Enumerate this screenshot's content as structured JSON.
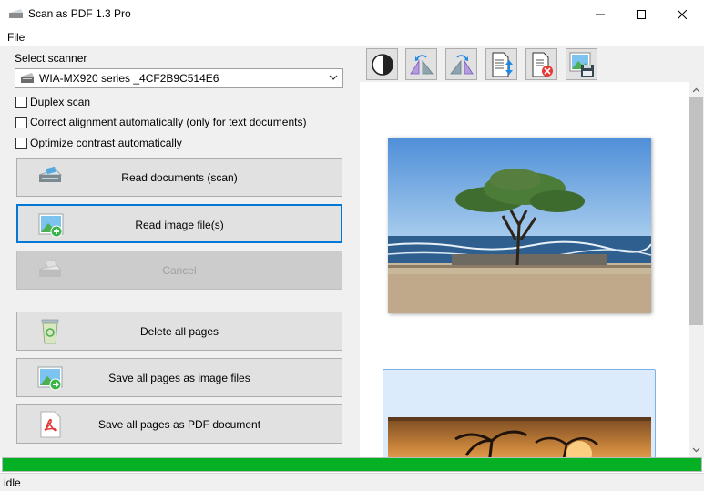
{
  "window": {
    "title": "Scan as PDF 1.3 Pro",
    "controls": [
      "minimize",
      "maximize",
      "close"
    ]
  },
  "menu": {
    "items": [
      {
        "label": "File"
      }
    ]
  },
  "scanner": {
    "label": "Select scanner",
    "selected": "WIA-MX920 series _4CF2B9C514E6"
  },
  "options": [
    {
      "label": "Duplex scan",
      "checked": false
    },
    {
      "label": "Correct alignment automatically (only for text documents)",
      "checked": false
    },
    {
      "label": "Optimize contrast automatically",
      "checked": false
    }
  ],
  "actions": {
    "scan": {
      "label": "Read documents (scan)",
      "icon": "scanner-icon"
    },
    "read_image": {
      "label": "Read image file(s)",
      "icon": "add-image-icon",
      "focused": true
    },
    "cancel": {
      "label": "Cancel",
      "icon": "scanner-disabled-icon",
      "enabled": false
    },
    "delete_all": {
      "label": "Delete all pages",
      "icon": "recycle-bin-icon"
    },
    "save_images": {
      "label": "Save all pages as image files",
      "icon": "save-image-icon"
    },
    "save_pdf": {
      "label": "Save all pages as PDF document",
      "icon": "pdf-icon"
    }
  },
  "toolbar": {
    "tools": [
      "contrast-icon",
      "rotate-left-icon",
      "rotate-right-icon",
      "move-page-icon",
      "delete-page-icon",
      "save-page-icon"
    ]
  },
  "preview": {
    "pages": [
      {
        "subject": "tree on beach photo",
        "selected": false
      },
      {
        "subject": "palm trees at sunset photo",
        "selected": true
      }
    ]
  },
  "progress": {
    "value": 1.0
  },
  "status": {
    "text": "idle"
  },
  "colors": {
    "accent": "#0078d7",
    "progress": "#06b025",
    "panel": "#f0f0f0",
    "button": "#e1e1e1"
  }
}
